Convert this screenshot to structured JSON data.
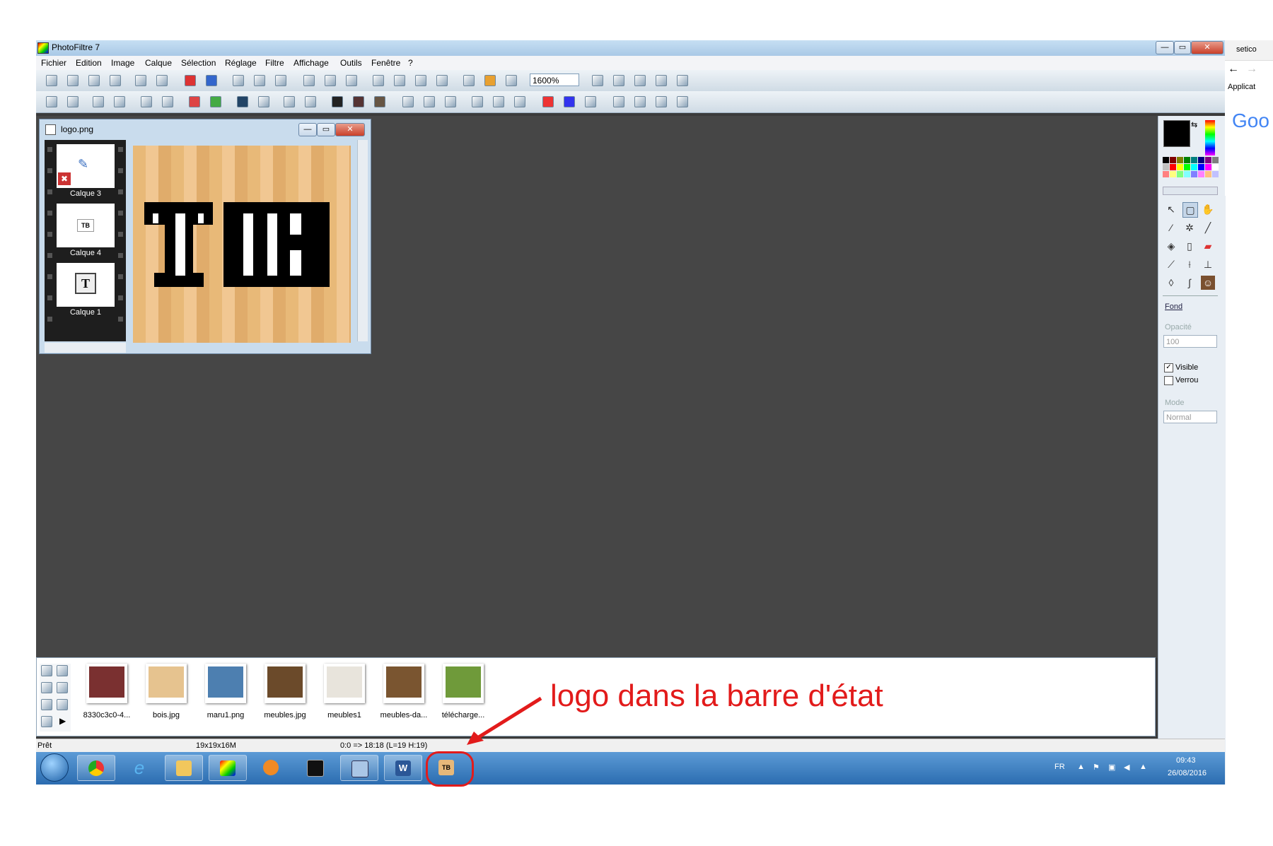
{
  "app": {
    "title": "PhotoFiltre 7",
    "menus": [
      "Fichier",
      "Edition",
      "Image",
      "Calque",
      "Sélection",
      "Réglage",
      "Filtre",
      "Affichage",
      "Outils",
      "Fenêtre",
      "?"
    ],
    "zoom": "1600%"
  },
  "document": {
    "title": "logo.png",
    "layers": [
      {
        "label": "Calque 3"
      },
      {
        "label": "Calque 4"
      },
      {
        "label": "Calque 1"
      }
    ]
  },
  "panel": {
    "fond_link": "Fond",
    "opacity_label": "Opacité",
    "opacity_value": "100",
    "visible_label": "Visible",
    "visible_checked": true,
    "lock_label": "Verrou",
    "lock_checked": false,
    "mode_label": "Mode",
    "mode_value": "Normal",
    "palette": [
      "#000000",
      "#7f0000",
      "#7f7f00",
      "#007f00",
      "#007f7f",
      "#00007f",
      "#7f007f",
      "#7f7f7f",
      "#c0c0c0",
      "#ff0000",
      "#ffff00",
      "#00ff00",
      "#00ffff",
      "#0000ff",
      "#ff00ff",
      "#ffffff",
      "#ff8080",
      "#ffff80",
      "#80ff80",
      "#80ffff",
      "#8080ff",
      "#ff80ff",
      "#ffc080",
      "#c0c0ff"
    ]
  },
  "thumbnails": [
    {
      "label": "8330c3c0-4...",
      "color": "#7a3030"
    },
    {
      "label": "bois.jpg",
      "color": "#e6c38f"
    },
    {
      "label": "maru1.png",
      "color": "#4d7fb0"
    },
    {
      "label": "meubles.jpg",
      "color": "#6b4a2a"
    },
    {
      "label": "meubles1",
      "color": "#e8e4dc"
    },
    {
      "label": "meubles-da...",
      "color": "#7a5530"
    },
    {
      "label": "télécharge...",
      "color": "#6f9a3a"
    }
  ],
  "status": {
    "ready": "Prêt",
    "size": "19x19x16M",
    "coords": "0:0 => 18:18 (L=19  H:19)"
  },
  "taskbar": {
    "lang": "FR",
    "time": "09:43",
    "date": "26/08/2016"
  },
  "chrome": {
    "tab": "setico",
    "bookmark": "Applicat",
    "logo": "Goo"
  },
  "annotation": {
    "text": "logo dans la barre d'état",
    "color": "#e21b1b"
  }
}
